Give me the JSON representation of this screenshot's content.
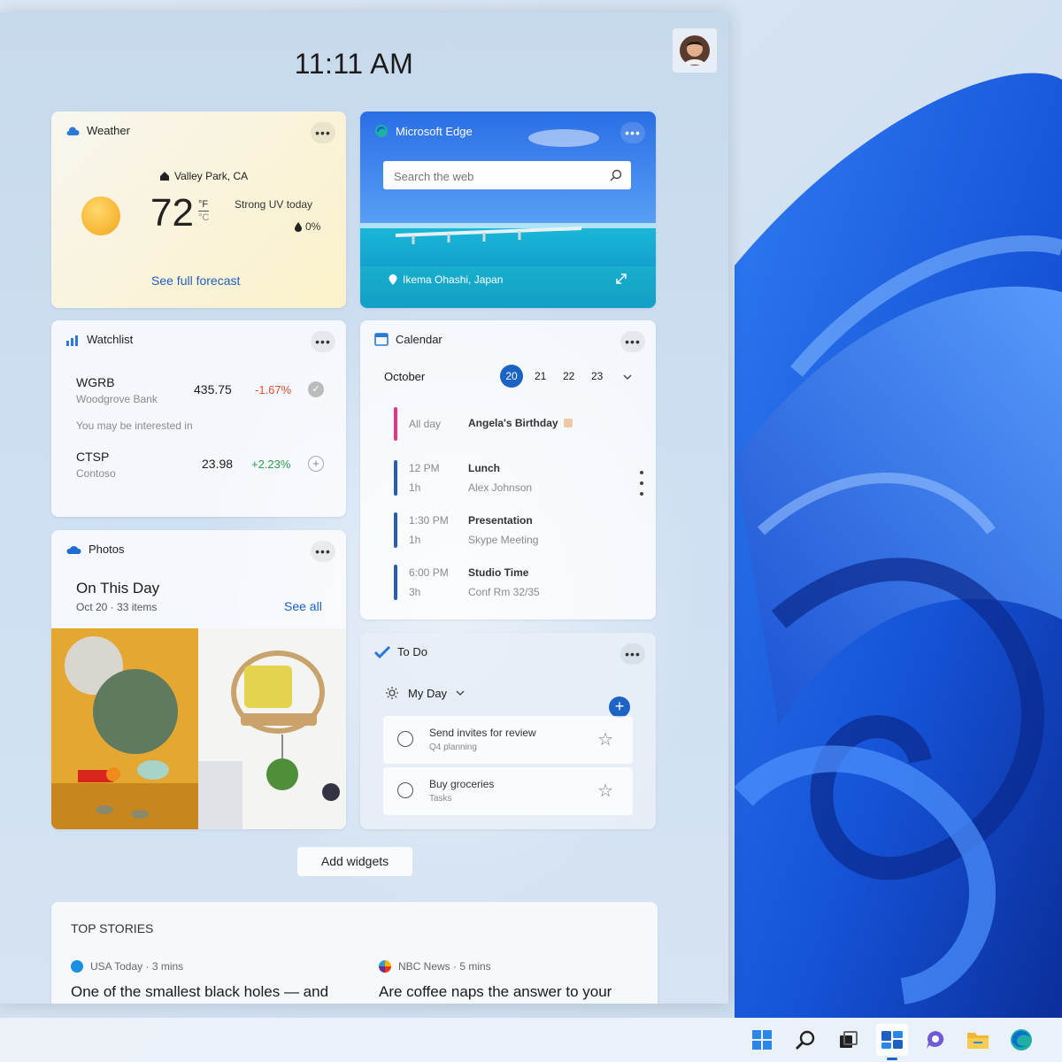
{
  "clock": "11:11 AM",
  "weather": {
    "title": "Weather",
    "location": "Valley Park, CA",
    "temp": "72",
    "unit_f": "°F",
    "unit_c": "°C",
    "condition": "Strong UV today",
    "precip": "0%",
    "link": "See full forecast"
  },
  "edge": {
    "title": "Microsoft Edge",
    "search_placeholder": "Search the web",
    "location": "Ikema Ohashi, Japan"
  },
  "watchlist": {
    "title": "Watchlist",
    "stocks": [
      {
        "symbol": "WGRB",
        "name": "Woodgrove Bank",
        "price": "435.75",
        "change": "-1.67%",
        "color": "#e0502f"
      },
      {
        "symbol": "CTSP",
        "name": "Contoso",
        "price": "23.98",
        "change": "+2.23%",
        "color": "#2e9c4f"
      }
    ],
    "suggestion": "You may be interested in"
  },
  "calendar": {
    "title": "Calendar",
    "month": "October",
    "days": [
      "20",
      "21",
      "22",
      "23"
    ],
    "events": [
      {
        "time": "All day",
        "duration": "",
        "title": "Angela's Birthday",
        "sub": "",
        "color": "#e3358a"
      },
      {
        "time": "12 PM",
        "duration": "1h",
        "title": "Lunch",
        "sub": "Alex Johnson",
        "color": "#2a5db0"
      },
      {
        "time": "1:30 PM",
        "duration": "1h",
        "title": "Presentation",
        "sub": "Skype Meeting",
        "color": "#2a5db0"
      },
      {
        "time": "6:00 PM",
        "duration": "3h",
        "title": "Studio Time",
        "sub": "Conf Rm 32/35",
        "color": "#2a5db0"
      }
    ]
  },
  "photos": {
    "title": "Photos",
    "heading": "On This Day",
    "sub": "Oct 20 · 33 items",
    "link": "See all"
  },
  "todo": {
    "title": "To Do",
    "list": "My Day",
    "items": [
      {
        "title": "Send invites for review",
        "sub": "Q4 planning"
      },
      {
        "title": "Buy groceries",
        "sub": "Tasks"
      }
    ]
  },
  "add_widgets": "Add widgets",
  "top_stories": {
    "heading": "TOP STORIES",
    "stories": [
      {
        "source": "USA Today · 3 mins",
        "title": "One of the smallest black holes — and"
      },
      {
        "source": "NBC News · 5 mins",
        "title": "Are coffee naps the answer to your"
      }
    ]
  },
  "taskbar": [
    "start-icon",
    "search-icon",
    "task-view-icon",
    "widgets-icon",
    "chat-icon",
    "file-explorer-icon",
    "edge-icon"
  ]
}
